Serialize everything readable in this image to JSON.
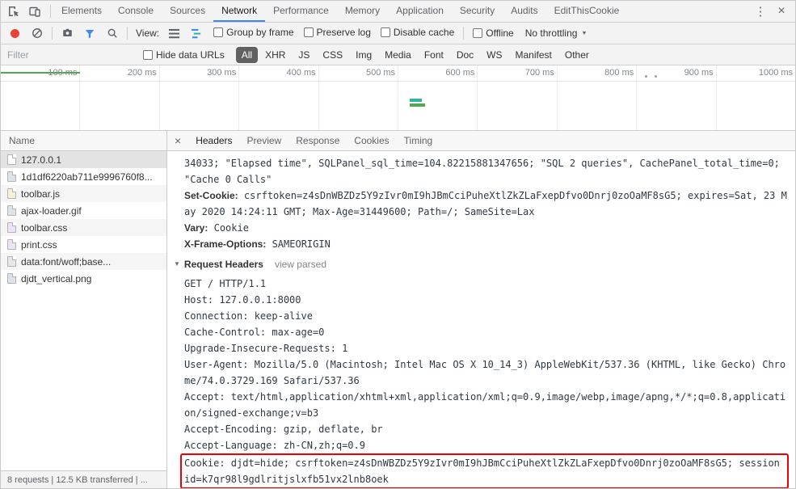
{
  "icons": {
    "close": "×",
    "more_options": "⋮",
    "dropdown_caret": "▼",
    "disclosure_expanded": "▼"
  },
  "colors": {
    "accent_blue": "#4285f4",
    "record_red": "#ea4335",
    "highlight_red": "#ec0000",
    "waterfall_green": "#54a754",
    "waterfall_teal": "#2fb3a6",
    "selected_chip_bg": "#616161"
  },
  "window": {
    "tabs": [
      "Elements",
      "Console",
      "Sources",
      "Network",
      "Performance",
      "Memory",
      "Application",
      "Security",
      "Audits",
      "EditThisCookie"
    ],
    "active_tab": "Network"
  },
  "network_toolbar": {
    "view_label": "View:",
    "checkboxes": [
      "Group by frame",
      "Preserve log",
      "Disable cache"
    ],
    "offline_label": "Offline",
    "throttling_label": "No throttling"
  },
  "filter_bar": {
    "filter_placeholder": "Filter",
    "hide_data_urls_label": "Hide data URLs",
    "type_filters": [
      "All",
      "XHR",
      "JS",
      "CSS",
      "Img",
      "Media",
      "Font",
      "Doc",
      "WS",
      "Manifest",
      "Other"
    ],
    "selected_filter": "All"
  },
  "timeline": {
    "ticks": [
      "100 ms",
      "200 ms",
      "300 ms",
      "400 ms",
      "500 ms",
      "600 ms",
      "700 ms",
      "800 ms",
      "900 ms",
      "1000 ms"
    ]
  },
  "request_list": {
    "column_header": "Name",
    "rows": [
      {
        "name": "127.0.0.1",
        "type": "document",
        "selected": true
      },
      {
        "name": "1d1df6220ab711e9996760f8...",
        "type": "image"
      },
      {
        "name": "toolbar.js",
        "type": "script"
      },
      {
        "name": "ajax-loader.gif",
        "type": "image"
      },
      {
        "name": "toolbar.css",
        "type": "stylesheet"
      },
      {
        "name": "print.css",
        "type": "stylesheet"
      },
      {
        "name": "data:font/woff;base...",
        "type": "font"
      },
      {
        "name": "djdt_vertical.png",
        "type": "image"
      }
    ]
  },
  "details": {
    "tabs": [
      "Headers",
      "Preview",
      "Response",
      "Cookies",
      "Timing"
    ],
    "active_tab": "Headers",
    "response_headers": [
      {
        "name": "",
        "value": "34033; \"Elapsed time\", SQLPanel_sql_time=104.82215881347656; \"SQL 2 queries\", CachePanel_total_time=0; \"Cache 0 Calls\""
      },
      {
        "name": "Set-Cookie:",
        "value": "csrftoken=z4sDnWBZDz5Y9zIvr0mI9hJBmCciPuheXtlZkZLaFxepDfvo0Dnrj0zoOaMF8sG5; expires=Sat, 23 May 2020 14:24:11 GMT; Max-Age=31449600; Path=/; SameSite=Lax"
      },
      {
        "name": "Vary:",
        "value": "Cookie"
      },
      {
        "name": "X-Frame-Options:",
        "value": "SAMEORIGIN"
      }
    ],
    "request_headers": {
      "section_title": "Request Headers",
      "view_parsed_label": "view parsed",
      "raw_lines": [
        {
          "text": "GET / HTTP/1.1"
        },
        {
          "text": "Host: 127.0.0.1:8000"
        },
        {
          "text": "Connection: keep-alive"
        },
        {
          "text": "Cache-Control: max-age=0"
        },
        {
          "text": "Upgrade-Insecure-Requests: 1"
        },
        {
          "text": "User-Agent: Mozilla/5.0 (Macintosh; Intel Mac OS X 10_14_3) AppleWebKit/537.36 (KHTML, like Gecko) Chrome/74.0.3729.169 Safari/537.36"
        },
        {
          "text": "Accept: text/html,application/xhtml+xml,application/xml;q=0.9,image/webp,image/apng,*/*;q=0.8,application/signed-exchange;v=b3"
        },
        {
          "text": "Accept-Encoding: gzip, deflate, br"
        },
        {
          "text": "Accept-Language: zh-CN,zh;q=0.9"
        },
        {
          "text": "Cookie: djdt=hide; csrftoken=z4sDnWBZDz5Y9zIvr0mI9hJBmCciPuheXtlZkZLaFxepDfvo0Dnrj0zoOaMF8sG5; sessionid=k7qr98l9gdlritjslxfb51vx2lnb8oek",
          "highlighted": true
        }
      ]
    }
  },
  "status_bar": {
    "text": "8 requests | 12.5 KB transferred | ..."
  }
}
